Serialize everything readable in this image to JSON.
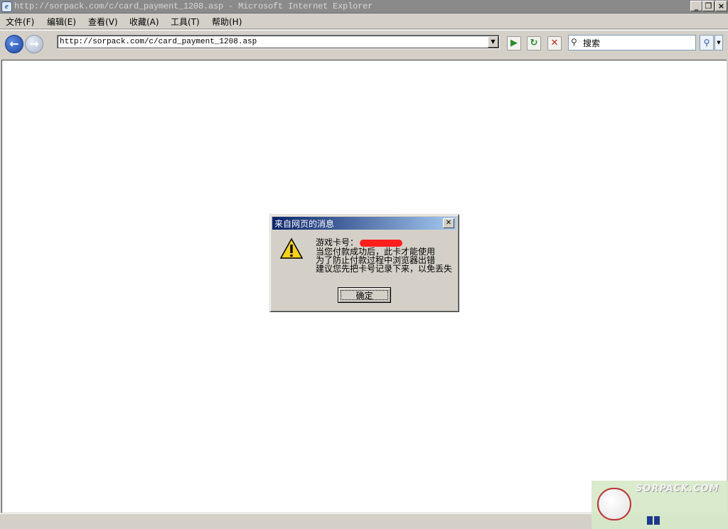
{
  "window": {
    "title": "http://sorpack.com/c/card_payment_1208.asp - Microsoft Internet Explorer",
    "controls": {
      "minimize": "_",
      "maximize": "❐",
      "close": "×"
    }
  },
  "menu": {
    "items": [
      "文件(F)",
      "编辑(E)",
      "查看(V)",
      "收藏(A)",
      "工具(T)",
      "帮助(H)"
    ]
  },
  "toolbar": {
    "address": "http://sorpack.com/c/card_payment_1208.asp",
    "search_value": "搜索",
    "icons": [
      "back-icon",
      "forward-icon",
      "go-icon",
      "refresh-icon",
      "stop-icon",
      "search-icon"
    ]
  },
  "dialog": {
    "title": "来自网页的消息",
    "lines": [
      "游戏卡号：",
      "当您付款成功后，此卡才能使用",
      "为了防止付款过程中浏览器出错",
      "建议您先把卡号记录下来，以免丢失"
    ],
    "ok_label": "确定",
    "icon": "warning-icon"
  },
  "watermark": {
    "text": "SORPACK.COM"
  },
  "colors": {
    "dialog_title_start": "#0a246a",
    "dialog_title_end": "#a6caf0",
    "redaction": "#ff1f1f",
    "chrome": "#d4d0c8"
  }
}
